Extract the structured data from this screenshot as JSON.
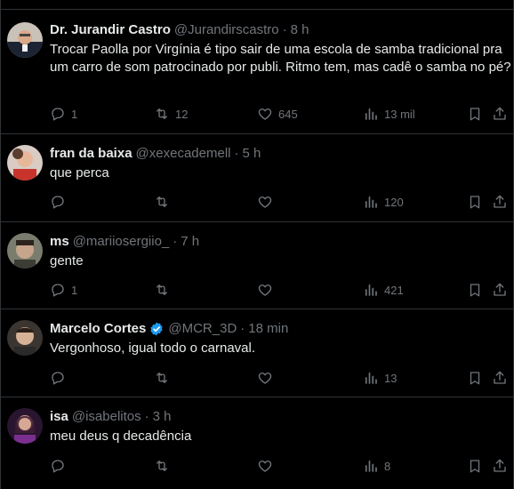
{
  "tweets": [
    {
      "name": "Dr. Jurandir Castro",
      "handle": "@Jurandirscastro",
      "time": "8 h",
      "verified": false,
      "text": "Trocar Paolla por Virgínia é tipo sair de uma escola de samba tradicional pra um carro de som patrocinado por publi. Ritmo tem, mas cadê o samba no pé?",
      "replies": "1",
      "retweets": "12",
      "likes": "645",
      "views": "13 mil"
    },
    {
      "name": "fran da baixa",
      "handle": "@xexecademell",
      "time": "5 h",
      "verified": false,
      "text": "que perca",
      "replies": "",
      "retweets": "",
      "likes": "",
      "views": "120"
    },
    {
      "name": "ms",
      "handle": "@mariiosergiio_",
      "time": "7 h",
      "verified": false,
      "text": "gente",
      "replies": "1",
      "retweets": "",
      "likes": "",
      "views": "421"
    },
    {
      "name": "Marcelo Cortes",
      "handle": "@MCR_3D",
      "time": "18 min",
      "verified": true,
      "text": "Vergonhoso, igual todo o carnaval.",
      "replies": "",
      "retweets": "",
      "likes": "",
      "views": "13"
    },
    {
      "name": "isa",
      "handle": "@isabelitos",
      "time": "3 h",
      "verified": false,
      "text": "meu deus q decadência",
      "replies": "",
      "retweets": "",
      "likes": "",
      "views": "8"
    }
  ],
  "colors": {
    "background": "#000000",
    "text": "#e7e9ea",
    "muted": "#71767b",
    "border": "#2f3336",
    "verified": "#1d9bf0"
  }
}
